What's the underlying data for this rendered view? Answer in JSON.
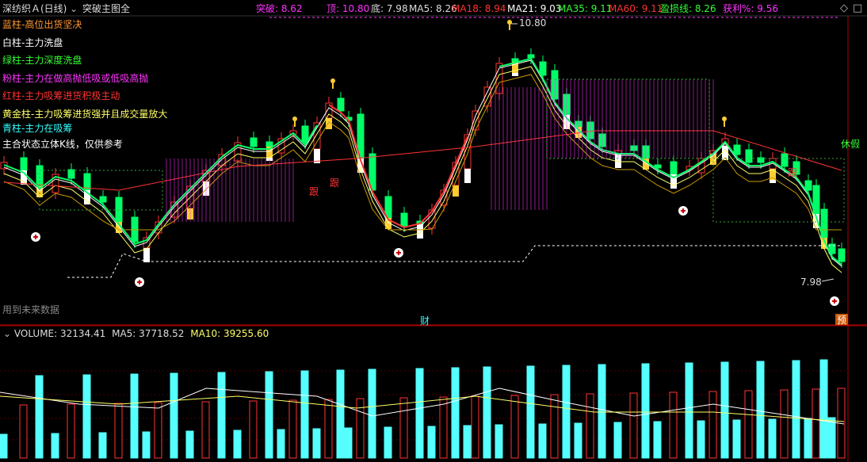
{
  "header": {
    "title": "深纺织Ａ(日线)",
    "indicator": "突破主图全",
    "items": [
      {
        "label": "突破: ",
        "value": "8.62",
        "color": "#ff33ff"
      },
      {
        "label": "顶: ",
        "value": "10.80",
        "color": "#ff33ff"
      },
      {
        "label": "底: ",
        "value": "7.98",
        "color": "#dddddd"
      },
      {
        "label": "MA5: ",
        "value": "8.26",
        "color": "#dddddd"
      },
      {
        "label": "MA18: ",
        "value": "8.94",
        "color": "#ff3333"
      },
      {
        "label": "MA21: ",
        "value": "9.03",
        "color": "#ffffff"
      },
      {
        "label": "MA35: ",
        "value": "9.11",
        "color": "#33ff33"
      },
      {
        "label": "MA60: ",
        "value": "9.11",
        "color": "#ff3333"
      },
      {
        "label": "盈损线: ",
        "value": "8.26",
        "color": "#33ff33"
      },
      {
        "label": "获利%: ",
        "value": "9.56",
        "color": "#ff33ff"
      }
    ]
  },
  "legend": [
    {
      "text": "蓝柱-高位出货坚决",
      "color": "#ff9933"
    },
    {
      "text": "白柱-主力洗盘",
      "color": "#ffffff"
    },
    {
      "text": "绿柱-主力深度洗盘",
      "color": "#33ff33"
    },
    {
      "text": "粉柱-主力在做高抛低吸或低吸高抛",
      "color": "#ff33ff"
    },
    {
      "text": "红柱-主力吸筹进货积极主动",
      "color": "#ff3333"
    },
    {
      "text": "黄金柱-主力吸筹进货强并且成交量放大",
      "color": "#ffff66"
    },
    {
      "text": "青柱-主力在吸筹",
      "color": "#33ffff"
    },
    {
      "text": "主合状态立体K线，仅供参考",
      "color": "#ffffff"
    }
  ],
  "annotations": {
    "peak_label": "10.80",
    "bottom_label": "7.98",
    "follow_mark": "跟",
    "holiday": "休假",
    "future_note": "用到未来数据",
    "finance_mark": "财",
    "forecast_mark": "预"
  },
  "volume": {
    "title": "VOLUME: ",
    "value": "32134.41",
    "ma5_label": "MA5: ",
    "ma5": "37718.52",
    "ma10_label": "MA10: ",
    "ma10": "39255.60"
  },
  "colors": {
    "up": "#ff3333",
    "down": "#00ff66",
    "volume_down": "#55ffff",
    "volume_up": "#ff3333",
    "ma_yellow": "#ffff66",
    "ma_red": "#ff3333",
    "dashed_support": "#ffffff",
    "resistance": "#ff33ff"
  },
  "controls": {
    "settings_icon": "diamond-icon",
    "window_icon": "window-icon"
  }
}
